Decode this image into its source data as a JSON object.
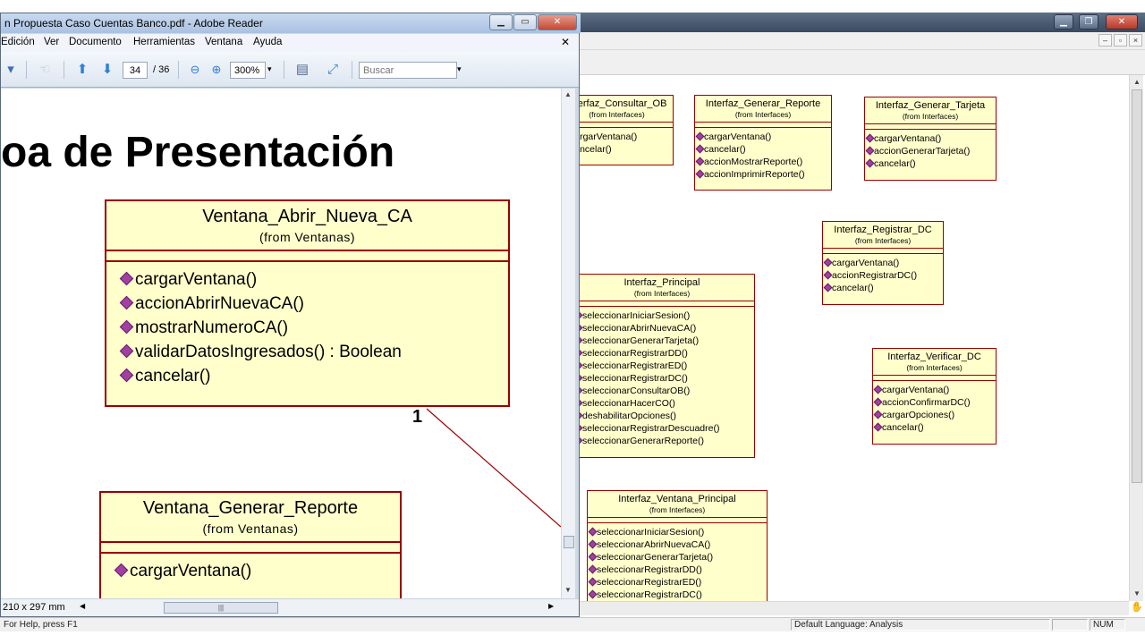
{
  "rose": {
    "status_help": "For Help, press F1",
    "status_language": "Default Language: Analysis",
    "status_num": "NUM",
    "classes": [
      {
        "name": "Interfaz_Consultar_OB",
        "from": "(from Interfaces)",
        "ops": [
          "cargarVentana()",
          "cancelar()"
        ]
      },
      {
        "name": "Interfaz_Generar_Reporte",
        "from": "(from Interfaces)",
        "ops": [
          "cargarVentana()",
          "cancelar()",
          "accionMostrarReporte()",
          "accionImprimirReporte()"
        ]
      },
      {
        "name": "Interfaz_Generar_Tarjeta",
        "from": "(from Interfaces)",
        "ops": [
          "cargarVentana()",
          "accionGenerarTarjeta()",
          "cancelar()"
        ]
      },
      {
        "name": "Interfaz_Registrar_DC",
        "from": "(from Interfaces)",
        "ops": [
          "cargarVentana()",
          "accionRegistrarDC()",
          "cancelar()"
        ]
      },
      {
        "name": "Interfaz_Principal",
        "from": "(from Interfaces)",
        "ops": [
          "seleccionarIniciarSesion()",
          "seleccionarAbrirNuevaCA()",
          "seleccionarGenerarTarjeta()",
          "seleccionarRegistrarDD()",
          "seleccionarRegistrarED()",
          "seleccionarRegistrarDC()",
          "seleccionarConsultarOB()",
          "seleccionarHacerCO()",
          "deshabilitarOpciones()",
          "seleccionarRegistrarDescuadre()",
          "seleccionarGenerarReporte()"
        ]
      },
      {
        "name": "Interfaz_Verificar_DC",
        "from": "(from Interfaces)",
        "ops": [
          "cargarVentana()",
          "accionConfirmarDC()",
          "cargarOpciones()",
          "cancelar()"
        ]
      },
      {
        "name": "Interfaz_Ventana_Principal",
        "from": "(from Interfaces)",
        "ops": [
          "seleccionarIniciarSesion()",
          "seleccionarAbrirNuevaCA()",
          "seleccionarGenerarTarjeta()",
          "seleccionarRegistrarDD()",
          "seleccionarRegistrarED()",
          "seleccionarRegistrarDC()"
        ]
      }
    ]
  },
  "reader": {
    "title": "n Propuesta Caso Cuentas Banco.pdf - Adobe Reader",
    "menu": [
      "Edición",
      "Ver",
      "Documento",
      "Herramientas",
      "Ventana",
      "Ayuda"
    ],
    "page_current": "34",
    "page_total": "/ 36",
    "zoom": "300%",
    "search_placeholder": "Buscar",
    "page_dims": "210 x 297 mm",
    "doc": {
      "heading": "oa de Presentación",
      "multiplicity": "1",
      "classes": [
        {
          "name": "Ventana_Abrir_Nueva_CA",
          "from": "(from Ventanas)",
          "ops": [
            "cargarVentana()",
            "accionAbrirNuevaCA()",
            "mostrarNumeroCA()",
            "validarDatosIngresados() : Boolean",
            "cancelar()"
          ]
        },
        {
          "name": "Ventana_Generar_Reporte",
          "from": "(from Ventanas)",
          "ops": [
            "cargarVentana()"
          ]
        }
      ]
    }
  },
  "colors": {
    "class_fill": "#ffffcc",
    "class_border": "#990000",
    "op_icon": "#a040a0"
  }
}
